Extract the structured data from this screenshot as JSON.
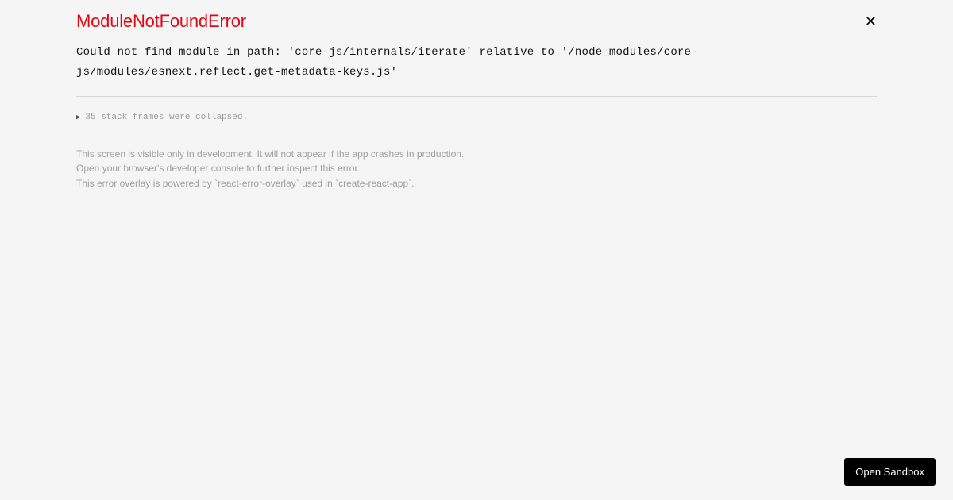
{
  "error": {
    "title": "ModuleNotFoundError",
    "message": "Could not find module in path: 'core-js/internals/iterate' relative to '/node_modules/core-js/modules/esnext.reflect.get-metadata-keys.js'"
  },
  "stack": {
    "toggle_label": "35 stack frames were collapsed."
  },
  "footer": {
    "line1": "This screen is visible only in development. It will not appear if the app crashes in production.",
    "line2": "Open your browser's developer console to further inspect this error.",
    "line3": "This error overlay is powered by `react-error-overlay` used in `create-react-app`."
  },
  "actions": {
    "open_sandbox": "Open Sandbox"
  },
  "icons": {
    "close": "✕",
    "arrow_right": "▶"
  }
}
